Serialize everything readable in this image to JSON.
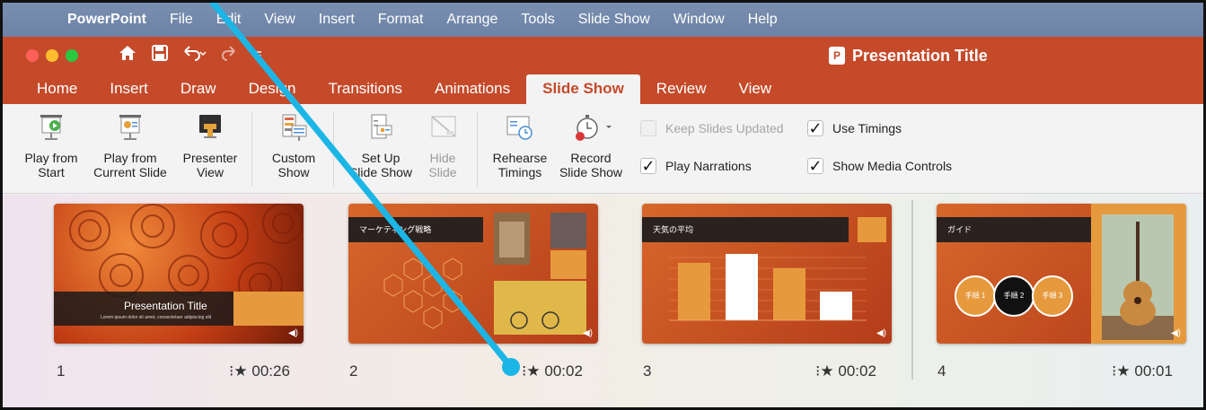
{
  "menubar": {
    "items": [
      "PowerPoint",
      "File",
      "Edit",
      "View",
      "Insert",
      "Format",
      "Arrange",
      "Tools",
      "Slide Show",
      "Window",
      "Help"
    ]
  },
  "titlebar": {
    "doc_title": "Presentation Title"
  },
  "tabs": [
    "Home",
    "Insert",
    "Draw",
    "Design",
    "Transitions",
    "Animations",
    "Slide Show",
    "Review",
    "View"
  ],
  "active_tab": "Slide Show",
  "ribbon": {
    "play_from_start": [
      "Play from",
      "Start"
    ],
    "play_from_current": [
      "Play from",
      "Current Slide"
    ],
    "presenter_view": [
      "Presenter",
      "View"
    ],
    "custom_show": [
      "Custom",
      "Show"
    ],
    "set_up": [
      "Set Up",
      "Slide Show"
    ],
    "hide_slide": [
      "Hide",
      "Slide"
    ],
    "rehearse": [
      "Rehearse",
      "Timings"
    ],
    "record": [
      "Record",
      "Slide Show"
    ],
    "keep_updated": "Keep Slides Updated",
    "use_timings": "Use Timings",
    "play_narrations": "Play Narrations",
    "show_media_controls": "Show Media Controls"
  },
  "slides": [
    {
      "number": "1",
      "time": "00:26",
      "title": "Presentation Title",
      "subtitle": "Lorem ipsum dolor sit amet, consectetuer adipiscing elit"
    },
    {
      "number": "2",
      "time": "00:02",
      "title": "マーケティング戦略"
    },
    {
      "number": "3",
      "time": "00:02",
      "title": "天気の平均"
    },
    {
      "number": "4",
      "time": "00:01",
      "title": "ガイド",
      "steps": [
        "手順 1",
        "手順 2",
        "手順 3"
      ]
    }
  ],
  "colors": {
    "brand": "#c54a2a",
    "annotation": "#1cb6e6"
  }
}
